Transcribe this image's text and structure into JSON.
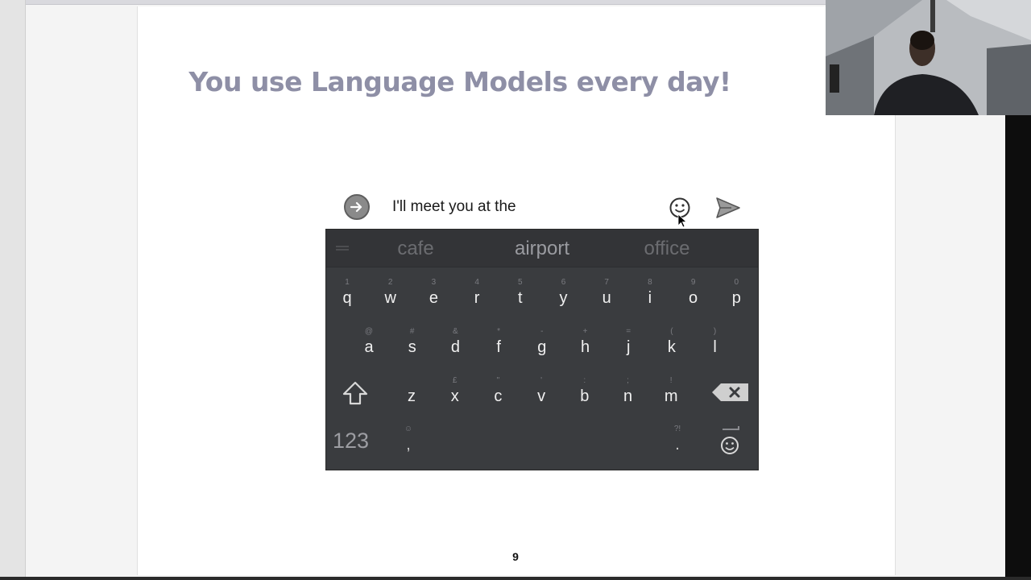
{
  "slide": {
    "title": "You use Language Models every day!",
    "page_number": "9"
  },
  "compose": {
    "text": "I'll meet you at the",
    "icons": [
      "forward-arrow-icon",
      "smiley-icon",
      "send-icon"
    ]
  },
  "keyboard": {
    "suggestions": [
      "cafe",
      "airport",
      "office"
    ],
    "row1": [
      {
        "ch": "q",
        "hint": "1"
      },
      {
        "ch": "w",
        "hint": "2"
      },
      {
        "ch": "e",
        "hint": "3"
      },
      {
        "ch": "r",
        "hint": "4"
      },
      {
        "ch": "t",
        "hint": "5"
      },
      {
        "ch": "y",
        "hint": "6"
      },
      {
        "ch": "u",
        "hint": "7"
      },
      {
        "ch": "i",
        "hint": "8"
      },
      {
        "ch": "o",
        "hint": "9"
      },
      {
        "ch": "p",
        "hint": "0"
      }
    ],
    "row2": [
      {
        "ch": "a",
        "hint": "@"
      },
      {
        "ch": "s",
        "hint": "#"
      },
      {
        "ch": "d",
        "hint": "&"
      },
      {
        "ch": "f",
        "hint": "*"
      },
      {
        "ch": "g",
        "hint": "-"
      },
      {
        "ch": "h",
        "hint": "+"
      },
      {
        "ch": "j",
        "hint": "="
      },
      {
        "ch": "k",
        "hint": "("
      },
      {
        "ch": "l",
        "hint": ")"
      }
    ],
    "row3": [
      {
        "ch": "z",
        "hint": ""
      },
      {
        "ch": "x",
        "hint": "£"
      },
      {
        "ch": "c",
        "hint": "\""
      },
      {
        "ch": "v",
        "hint": "'"
      },
      {
        "ch": "b",
        "hint": ":"
      },
      {
        "ch": "n",
        "hint": ";"
      },
      {
        "ch": "m",
        "hint": "!"
      }
    ],
    "sym_label": "123",
    "comma": {
      "ch": ",",
      "hint": "☺"
    },
    "period": {
      "ch": ".",
      "hint": "?!"
    },
    "colors": {
      "background": "#3a3c3f",
      "suggest_bar": "#333437",
      "key_text": "#f0f0f0"
    }
  }
}
